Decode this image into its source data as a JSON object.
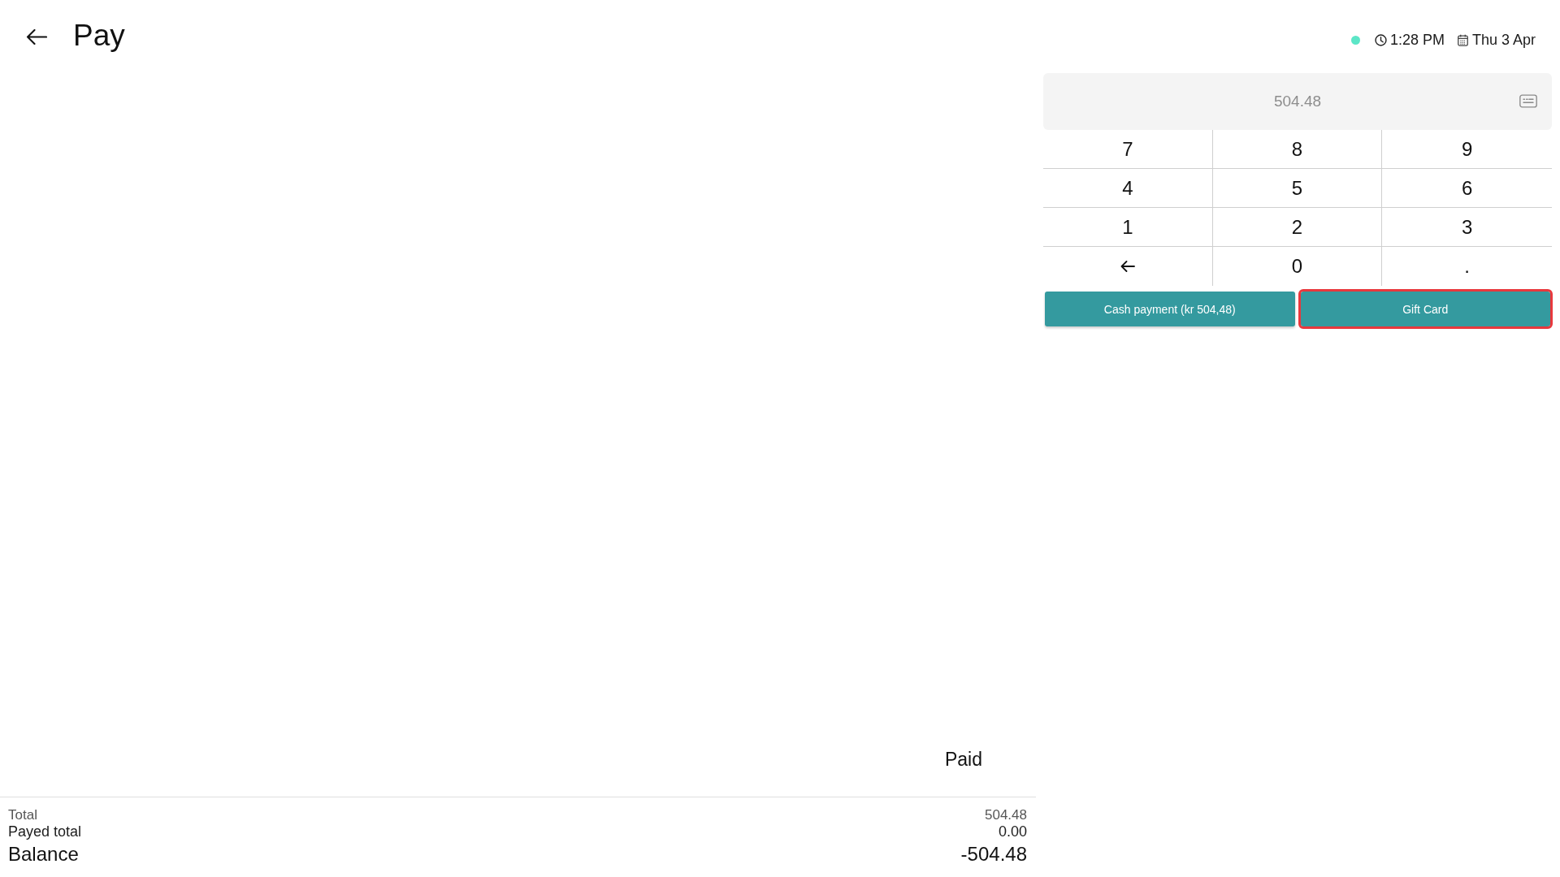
{
  "header": {
    "title": "Pay"
  },
  "status": {
    "online": true,
    "time": "1:28 PM",
    "date": "Thu 3 Apr"
  },
  "amount_field": {
    "placeholder": "504.48"
  },
  "keypad": {
    "keys": [
      {
        "kind": "digit",
        "label": "7"
      },
      {
        "kind": "digit",
        "label": "8"
      },
      {
        "kind": "digit",
        "label": "9"
      },
      {
        "kind": "digit",
        "label": "4"
      },
      {
        "kind": "digit",
        "label": "5"
      },
      {
        "kind": "digit",
        "label": "6"
      },
      {
        "kind": "digit",
        "label": "1"
      },
      {
        "kind": "digit",
        "label": "2"
      },
      {
        "kind": "digit",
        "label": "3"
      },
      {
        "kind": "backspace"
      },
      {
        "kind": "digit",
        "label": "0"
      },
      {
        "kind": "digit",
        "label": "."
      }
    ]
  },
  "payment_buttons": [
    {
      "label": "Cash payment (kr 504,48)",
      "highlighted": false
    },
    {
      "label": "Gift Card",
      "highlighted": true
    }
  ],
  "paid_label": "Paid",
  "totals": [
    {
      "kind": "total",
      "label": "Total",
      "value": "504.48"
    },
    {
      "kind": "payed",
      "label": "Payed total",
      "value": "0.00"
    },
    {
      "kind": "balance",
      "label": "Balance",
      "value": "-504.48"
    }
  ]
}
